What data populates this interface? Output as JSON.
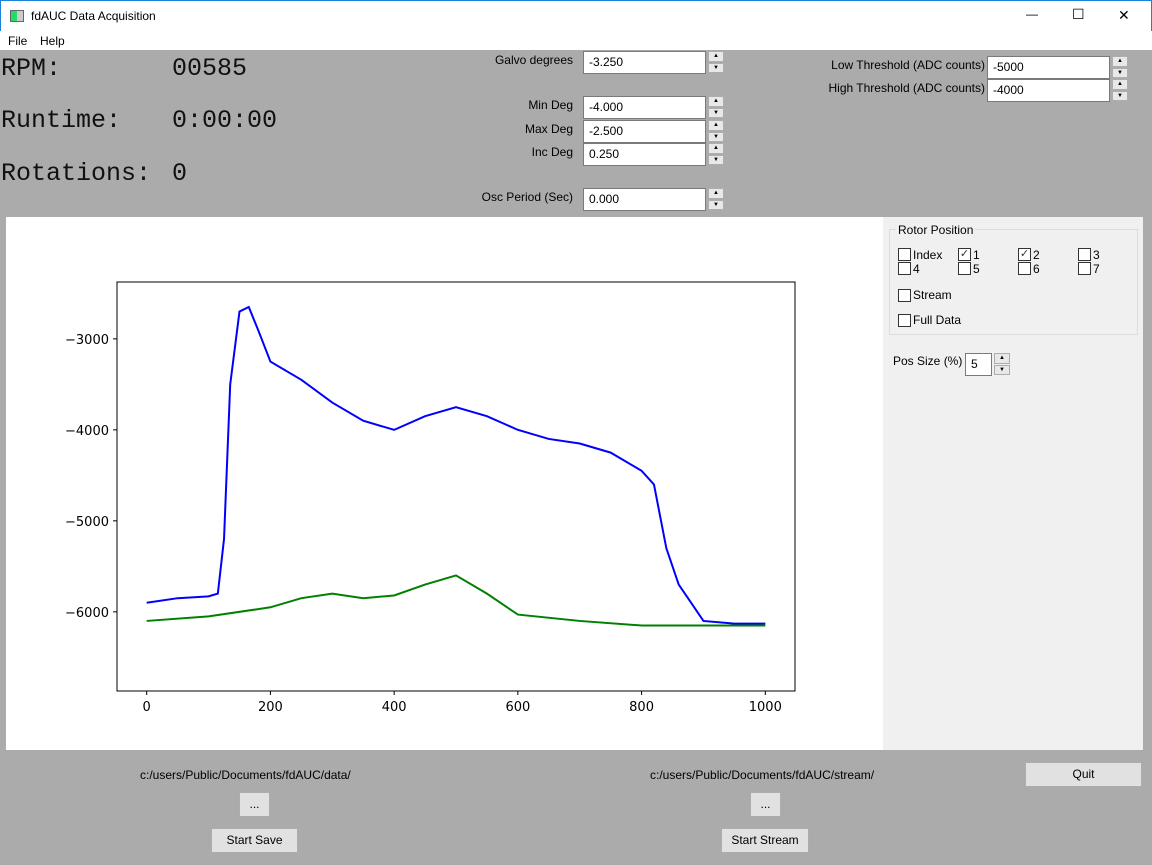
{
  "window": {
    "title": "fdAUC Data Acquisition",
    "minimize": "—",
    "maximize": "☐",
    "close": "✕"
  },
  "menu": [
    "File",
    "Help"
  ],
  "status": {
    "rpm_label": "RPM:",
    "rpm_value": "00585",
    "runtime_label": "Runtime:",
    "runtime_value": "0:00:00",
    "rotations_label": "Rotations:",
    "rotations_value": "0"
  },
  "controls": {
    "galvo": {
      "label": "Galvo degrees",
      "value": "-3.250"
    },
    "min_deg": {
      "label": "Min Deg",
      "value": "-4.000"
    },
    "max_deg": {
      "label": "Max Deg",
      "value": "-2.500"
    },
    "inc_deg": {
      "label": "Inc Deg",
      "value": "0.250"
    },
    "osc_period": {
      "label": "Osc Period (Sec)",
      "value": "0.000"
    },
    "low_threshold": {
      "label": "Low Threshold (ADC counts)",
      "value": "-5000"
    },
    "high_threshold": {
      "label": "High Threshold (ADC counts)",
      "value": "-4000"
    }
  },
  "rotor": {
    "title": "Rotor Position",
    "checkboxes": [
      {
        "label": "Index",
        "checked": false
      },
      {
        "label": "1",
        "checked": true
      },
      {
        "label": "2",
        "checked": true
      },
      {
        "label": "3",
        "checked": false
      },
      {
        "label": "4",
        "checked": false
      },
      {
        "label": "5",
        "checked": false
      },
      {
        "label": "6",
        "checked": false
      },
      {
        "label": "7",
        "checked": false
      }
    ],
    "stream": {
      "label": "Stream",
      "checked": false
    },
    "full_data": {
      "label": "Full Data",
      "checked": false
    },
    "pos_size": {
      "label": "Pos Size (%)",
      "value": "5"
    }
  },
  "bottom": {
    "data_path": "c:/users/Public/Documents/fdAUC/data/",
    "stream_path": "c:/users/Public/Documents/fdAUC/stream/",
    "browse": "...",
    "start_save": "Start Save",
    "start_stream": "Start Stream",
    "quit": "Quit"
  },
  "chart_data": {
    "type": "line",
    "xlim": [
      -48,
      1048
    ],
    "ylim": [
      -6870,
      -2375
    ],
    "xticks": [
      0,
      200,
      400,
      600,
      800,
      1000
    ],
    "yticks": [
      -3000,
      -4000,
      -5000,
      -6000
    ],
    "ytick_labels": [
      "−3000",
      "−4000",
      "−5000",
      "−6000"
    ],
    "series": [
      {
        "color": "#0000ff",
        "x": [
          0,
          50,
          100,
          115,
          125,
          135,
          150,
          165,
          180,
          200,
          250,
          300,
          350,
          400,
          450,
          500,
          550,
          600,
          650,
          700,
          750,
          800,
          820,
          840,
          860,
          880,
          900,
          950,
          1000
        ],
        "y": [
          -5900,
          -5850,
          -5830,
          -5800,
          -5200,
          -3500,
          -2700,
          -2650,
          -2900,
          -3250,
          -3450,
          -3700,
          -3900,
          -4000,
          -3850,
          -3750,
          -3850,
          -4000,
          -4100,
          -4150,
          -4250,
          -4450,
          -4600,
          -5300,
          -5700,
          -5900,
          -6100,
          -6130,
          -6130
        ]
      },
      {
        "color": "#008000",
        "x": [
          0,
          100,
          200,
          250,
          300,
          350,
          400,
          450,
          500,
          550,
          600,
          700,
          800,
          900,
          1000
        ],
        "y": [
          -6100,
          -6050,
          -5950,
          -5850,
          -5800,
          -5850,
          -5820,
          -5700,
          -5600,
          -5800,
          -6030,
          -6100,
          -6150,
          -6150,
          -6150
        ]
      }
    ]
  }
}
